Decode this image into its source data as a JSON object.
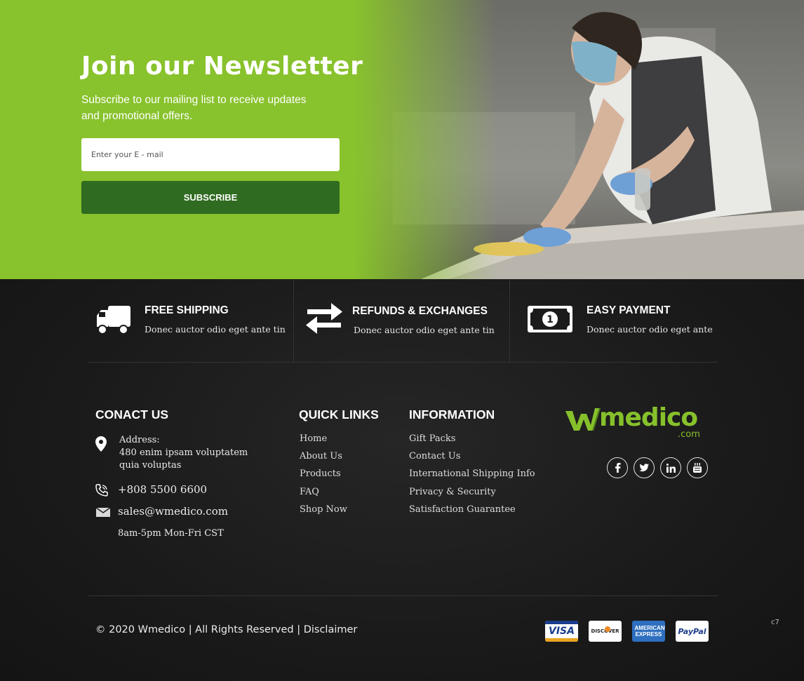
{
  "newsletter": {
    "title": "Join our Newsletter",
    "subtitle": "Subscribe to our mailing list to receive updates and promotional offers.",
    "email_placeholder": "Enter your E - mail",
    "subscribe_label": "SUBSCRIBE"
  },
  "features": [
    {
      "icon": "truck-icon",
      "title": "FREE SHIPPING",
      "text": "Donec auctor odio eget ante tin"
    },
    {
      "icon": "exchange-arrows-icon",
      "title": "REFUNDS & EXCHANGES",
      "text": "Donec auctor odio eget ante tin"
    },
    {
      "icon": "banknote-icon",
      "title": "EASY PAYMENT",
      "text": "Donec auctor odio eget ante"
    }
  ],
  "contact": {
    "heading": "CONACT US",
    "address_label": "Address:",
    "address_line1": "480 enim ipsam voluptatem",
    "address_line2": "quia voluptas",
    "phone": "+808 5500 6600",
    "email": "sales@wmedico.com",
    "hours": "8am-5pm Mon-Fri CST"
  },
  "quick_links": {
    "heading": "QUICK LINKS",
    "items": [
      "Home",
      "About Us",
      "Products",
      "FAQ",
      "Shop Now"
    ]
  },
  "information": {
    "heading": "INFORMATION",
    "items": [
      "Gift Packs",
      "Contact Us",
      "International Shipping Info",
      "Privacy & Security",
      "Satisfaction Guarantee"
    ]
  },
  "brand": {
    "logo_text": "Wmedico",
    "logo_suffix": ".com",
    "social": [
      "facebook-icon",
      "twitter-icon",
      "linkedin-icon",
      "youtube-icon"
    ]
  },
  "footer": {
    "copyright": "© 2020 Wmedico | All Rights Reserved | Disclaimer",
    "cards": [
      "VISA",
      "DISCOVER",
      "AMERICAN EXPRESS",
      "PayPal"
    ],
    "corner_code": "c7"
  },
  "colors": {
    "brand_green": "#86c12b",
    "button_green": "#2f6b20",
    "footer_bg": "#1b1b1b"
  }
}
